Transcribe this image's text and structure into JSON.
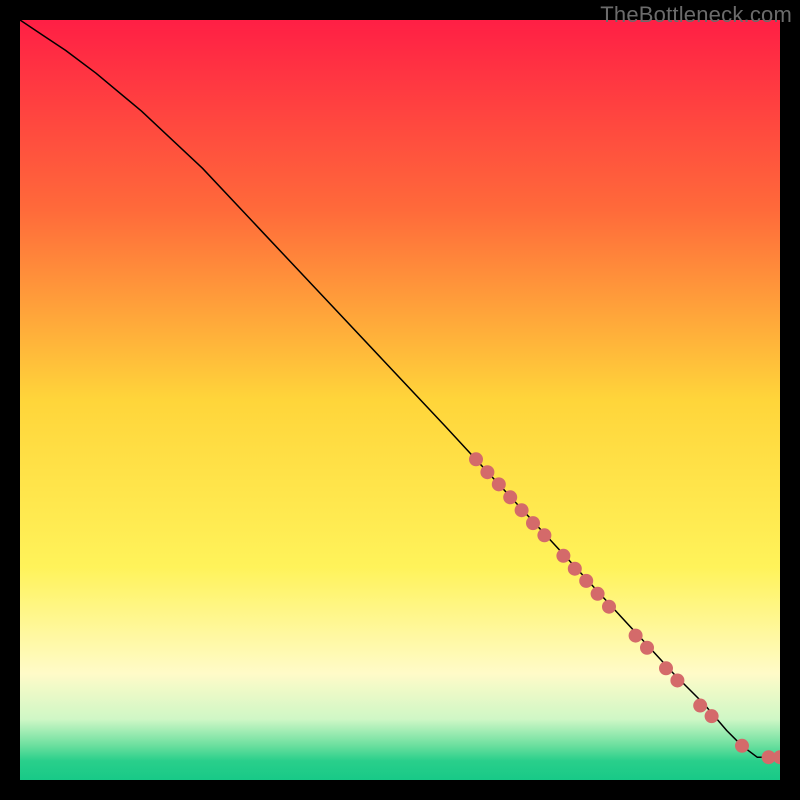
{
  "watermark": "TheBottleneck.com",
  "chart_data": {
    "type": "line",
    "title": "",
    "xlabel": "",
    "ylabel": "",
    "xlim": [
      0,
      100
    ],
    "ylim": [
      0,
      100
    ],
    "grid": false,
    "legend": false,
    "background_gradient": {
      "stops": [
        {
          "offset": 0.0,
          "color": "#ff1f45"
        },
        {
          "offset": 0.25,
          "color": "#ff6a3a"
        },
        {
          "offset": 0.5,
          "color": "#ffd53a"
        },
        {
          "offset": 0.72,
          "color": "#fff35a"
        },
        {
          "offset": 0.86,
          "color": "#fffbc8"
        },
        {
          "offset": 0.92,
          "color": "#cff7c6"
        },
        {
          "offset": 0.955,
          "color": "#6adf9e"
        },
        {
          "offset": 0.975,
          "color": "#29cf8b"
        },
        {
          "offset": 1.0,
          "color": "#18c987"
        }
      ]
    },
    "series": [
      {
        "name": "curve",
        "type": "line",
        "color": "#000000",
        "width": 1.5,
        "x": [
          0,
          3,
          6,
          10,
          16,
          24,
          32,
          40,
          48,
          56,
          62,
          68,
          74,
          80,
          86,
          90,
          93,
          95,
          97,
          100
        ],
        "y": [
          100,
          98,
          96,
          93,
          88,
          80.5,
          72,
          63.5,
          55,
          46.5,
          40,
          33.5,
          27,
          20.5,
          14,
          10,
          6.5,
          4.5,
          3,
          3
        ]
      },
      {
        "name": "highlight-points",
        "type": "scatter",
        "color": "#d46a6a",
        "radius": 7,
        "x": [
          60.0,
          61.5,
          63.0,
          64.5,
          66.0,
          67.5,
          69.0,
          71.5,
          73.0,
          74.5,
          76.0,
          77.5,
          81.0,
          82.5,
          85.0,
          86.5,
          89.5,
          91.0,
          95.0,
          98.5,
          100.0
        ],
        "y": [
          42.2,
          40.5,
          38.9,
          37.2,
          35.5,
          33.8,
          32.2,
          29.5,
          27.8,
          26.2,
          24.5,
          22.8,
          19.0,
          17.4,
          14.7,
          13.1,
          9.8,
          8.4,
          4.5,
          3.0,
          3.0
        ]
      }
    ]
  }
}
